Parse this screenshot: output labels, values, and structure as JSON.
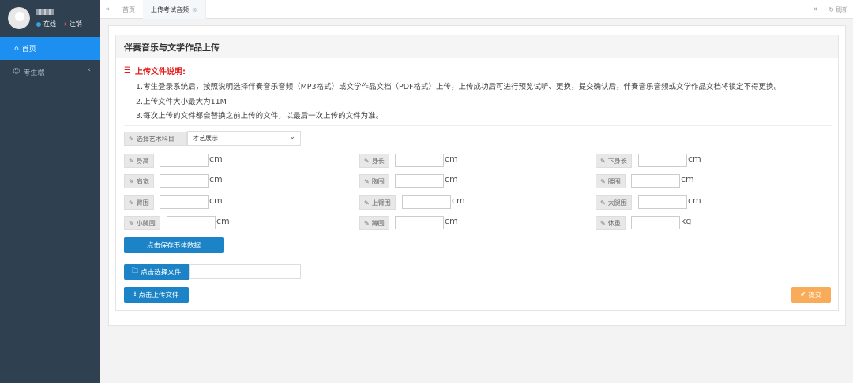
{
  "sidebar": {
    "status": {
      "online": "在线",
      "logout": "注销"
    },
    "nav": [
      {
        "label": "首页",
        "icon": "home-icon"
      },
      {
        "label": "考生端",
        "icon": "user-icon"
      }
    ]
  },
  "tabs": {
    "items": [
      {
        "label": "首页"
      },
      {
        "label": "上传考试音频"
      }
    ],
    "refresh_label": "刷新"
  },
  "panel": {
    "title": "伴奏音乐与文学作品上传",
    "notice_title": "上传文件说明:",
    "notices": [
      "1.考生登录系统后，按照说明选择伴奏音乐音频（MP3格式）或文学作品文档（PDF格式）上传，上传成功后可进行预览试听、更换，提交确认后，伴奏音乐音频或文学作品文档将锁定不得更换。",
      "2.上传文件大小最大为11M",
      "3.每次上传的文件都会替换之前上传的文件，以最后一次上传的文件为准。"
    ]
  },
  "form": {
    "subject_label": "选择艺术科目",
    "subject_value": "才艺展示",
    "fields": [
      {
        "label": "身高",
        "unit": "cm"
      },
      {
        "label": "身长",
        "unit": "cm"
      },
      {
        "label": "下身长",
        "unit": "cm"
      },
      {
        "label": "肩宽",
        "unit": "cm"
      },
      {
        "label": "胸围",
        "unit": "cm"
      },
      {
        "label": "腰围",
        "unit": "cm"
      },
      {
        "label": "臀围",
        "unit": "cm"
      },
      {
        "label": "上臂围",
        "unit": "cm"
      },
      {
        "label": "大腿围",
        "unit": "cm"
      },
      {
        "label": "小腿围",
        "unit": "cm"
      },
      {
        "label": "蹲围",
        "unit": "cm"
      },
      {
        "label": "体重",
        "unit": "kg"
      }
    ],
    "save_button": "点击保存形体数据",
    "choose_file_button": "点击选择文件",
    "upload_button": "点击上传文件",
    "submit_button": "提交"
  },
  "colors": {
    "sidebar_bg": "#2f4050",
    "nav_active": "#1c8ff0",
    "primary_button": "#1c84c6",
    "submit_button": "#f8ac59",
    "notice_title": "#e31b1b"
  }
}
